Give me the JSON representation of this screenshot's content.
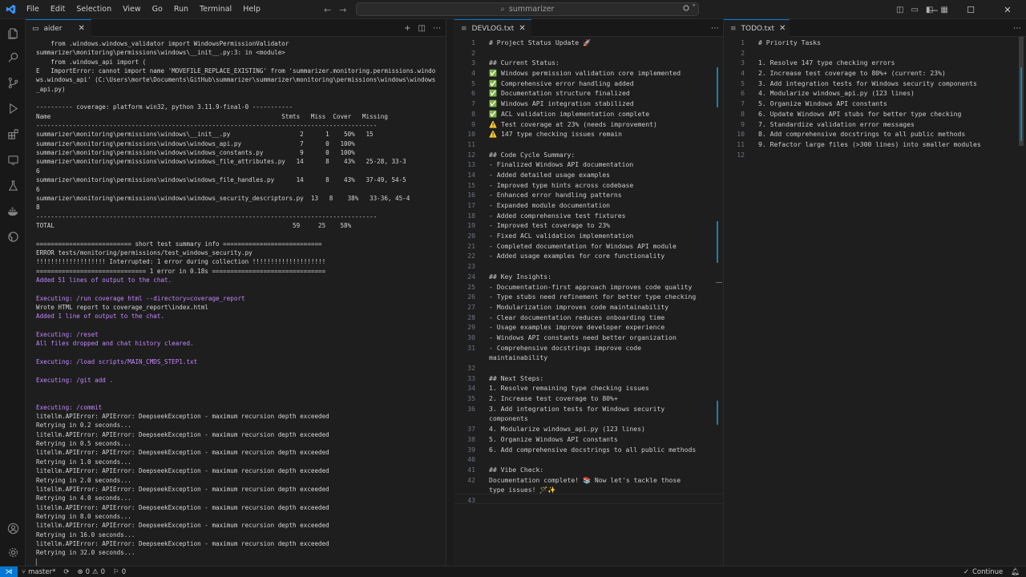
{
  "menu": [
    "File",
    "Edit",
    "Selection",
    "View",
    "Go",
    "Run",
    "Terminal",
    "Help"
  ],
  "search": {
    "text": "summarizer"
  },
  "terminal_tab": {
    "label": "aider"
  },
  "terminal_lines": [
    {
      "t": "    from .windows.windows_validator import WindowsPermissionValidator",
      "c": ""
    },
    {
      "t": "summarizer\\monitoring\\permissions\\windows\\__init__.py:3: in <module>",
      "c": ""
    },
    {
      "t": "    from .windows_api import (",
      "c": ""
    },
    {
      "t": "E   ImportError: cannot import name 'MOVEFILE_REPLACE_EXISTING' from 'summarizer.monitoring.permissions.windo",
      "c": ""
    },
    {
      "t": "ws.windows_api' (C:\\Users\\morte\\Documents\\GitHub\\summarizer\\summarizer\\monitoring\\permissions\\windows\\windows",
      "c": ""
    },
    {
      "t": "_api.py)",
      "c": ""
    },
    {
      "t": "",
      "c": ""
    },
    {
      "t": "---------- coverage: platform win32, python 3.11.9-final-0 -----------",
      "c": ""
    },
    {
      "t": "Name                                                               Stmts   Miss  Cover   Missing",
      "c": ""
    },
    {
      "t": "---------------------------------------------------------------------------------------------",
      "c": ""
    },
    {
      "t": "summarizer\\monitoring\\permissions\\windows\\__init__.py                   2      1    50%   15",
      "c": ""
    },
    {
      "t": "summarizer\\monitoring\\permissions\\windows\\windows_api.py                7      0   100%",
      "c": ""
    },
    {
      "t": "summarizer\\monitoring\\permissions\\windows\\windows_constants.py          9      0   100%",
      "c": ""
    },
    {
      "t": "summarizer\\monitoring\\permissions\\windows\\windows_file_attributes.py   14      8    43%   25-28, 33-3",
      "c": ""
    },
    {
      "t": "6",
      "c": ""
    },
    {
      "t": "summarizer\\monitoring\\permissions\\windows\\windows_file_handles.py      14      8    43%   37-49, 54-5",
      "c": ""
    },
    {
      "t": "6",
      "c": ""
    },
    {
      "t": "summarizer\\monitoring\\permissions\\windows\\windows_security_descriptors.py  13   8    38%   33-36, 45-4",
      "c": ""
    },
    {
      "t": "8",
      "c": ""
    },
    {
      "t": "---------------------------------------------------------------------------------------------",
      "c": ""
    },
    {
      "t": "TOTAL                                                                 59     25    58%",
      "c": ""
    },
    {
      "t": "",
      "c": ""
    },
    {
      "t": "========================== short test summary info ===========================",
      "c": ""
    },
    {
      "t": "ERROR tests/monitoring/permissions/test_windows_security.py",
      "c": ""
    },
    {
      "t": "!!!!!!!!!!!!!!!!!!! Interrupted: 1 error during collection !!!!!!!!!!!!!!!!!!!!",
      "c": ""
    },
    {
      "t": "============================== 1 error in 0.18s ===============================",
      "c": ""
    },
    {
      "t": "Added 51 lines of output to the chat.",
      "c": "purple"
    },
    {
      "t": "",
      "c": ""
    },
    {
      "t": "Executing: /run coverage html --directory=coverage_report",
      "c": "purple"
    },
    {
      "t": "Wrote HTML report to coverage_report\\index.html",
      "c": ""
    },
    {
      "t": "Added 1 line of output to the chat.",
      "c": "purple"
    },
    {
      "t": "",
      "c": ""
    },
    {
      "t": "Executing: /reset",
      "c": "purple"
    },
    {
      "t": "All files dropped and chat history cleared.",
      "c": "purple"
    },
    {
      "t": "",
      "c": ""
    },
    {
      "t": "Executing: /load scripts/MAIN_CMDS_STEP1.txt",
      "c": "purple"
    },
    {
      "t": "",
      "c": ""
    },
    {
      "t": "Executing: /git add .",
      "c": "purple"
    },
    {
      "t": "",
      "c": ""
    },
    {
      "t": "",
      "c": ""
    },
    {
      "t": "Executing: /commit",
      "c": "purple"
    },
    {
      "t": "litellm.APIError: APIError: DeepseekException - maximum recursion depth exceeded",
      "c": ""
    },
    {
      "t": "Retrying in 0.2 seconds...",
      "c": ""
    },
    {
      "t": "litellm.APIError: APIError: DeepseekException - maximum recursion depth exceeded",
      "c": ""
    },
    {
      "t": "Retrying in 0.5 seconds...",
      "c": ""
    },
    {
      "t": "litellm.APIError: APIError: DeepseekException - maximum recursion depth exceeded",
      "c": ""
    },
    {
      "t": "Retrying in 1.0 seconds...",
      "c": ""
    },
    {
      "t": "litellm.APIError: APIError: DeepseekException - maximum recursion depth exceeded",
      "c": ""
    },
    {
      "t": "Retrying in 2.0 seconds...",
      "c": ""
    },
    {
      "t": "litellm.APIError: APIError: DeepseekException - maximum recursion depth exceeded",
      "c": ""
    },
    {
      "t": "Retrying in 4.0 seconds...",
      "c": ""
    },
    {
      "t": "litellm.APIError: APIError: DeepseekException - maximum recursion depth exceeded",
      "c": ""
    },
    {
      "t": "Retrying in 8.0 seconds...",
      "c": ""
    },
    {
      "t": "litellm.APIError: APIError: DeepseekException - maximum recursion depth exceeded",
      "c": ""
    },
    {
      "t": "Retrying in 16.0 seconds...",
      "c": ""
    },
    {
      "t": "litellm.APIError: APIError: DeepseekException - maximum recursion depth exceeded",
      "c": ""
    },
    {
      "t": "Retrying in 32.0 seconds...",
      "c": ""
    },
    {
      "t": "▏",
      "c": ""
    }
  ],
  "devlog": {
    "tab_label": "DEVLOG.txt",
    "lines": [
      {
        "n": "1",
        "t": "# Project Status Update 🚀"
      },
      {
        "n": "2",
        "t": ""
      },
      {
        "n": "3",
        "t": "## Current Status:"
      },
      {
        "n": "4",
        "t": "✅ Windows permission validation core implemented"
      },
      {
        "n": "5",
        "t": "✅ Comprehensive error handling added"
      },
      {
        "n": "6",
        "t": "✅ Documentation structure finalized"
      },
      {
        "n": "7",
        "t": "✅ Windows API integration stabilized"
      },
      {
        "n": "8",
        "t": "✅ ACL validation implementation complete"
      },
      {
        "n": "9",
        "t": "⚠️ Test coverage at 23% (needs improvement)"
      },
      {
        "n": "10",
        "t": "⚠️ 147 type checking issues remain"
      },
      {
        "n": "11",
        "t": ""
      },
      {
        "n": "12",
        "t": "## Code Cycle Summary:"
      },
      {
        "n": "13",
        "t": "- Finalized Windows API documentation"
      },
      {
        "n": "14",
        "t": "- Added detailed usage examples"
      },
      {
        "n": "15",
        "t": "- Improved type hints across codebase"
      },
      {
        "n": "16",
        "t": "- Enhanced error handling patterns"
      },
      {
        "n": "17",
        "t": "- Expanded module documentation"
      },
      {
        "n": "18",
        "t": "- Added comprehensive test fixtures"
      },
      {
        "n": "19",
        "t": "- Improved test coverage to 23%"
      },
      {
        "n": "20",
        "t": "- Fixed ACL validation implementation"
      },
      {
        "n": "21",
        "t": "- Completed documentation for Windows API module"
      },
      {
        "n": "22",
        "t": "- Added usage examples for core functionality"
      },
      {
        "n": "23",
        "t": ""
      },
      {
        "n": "24",
        "t": "## Key Insights:"
      },
      {
        "n": "25",
        "t": "- Documentation-first approach improves code quality"
      },
      {
        "n": "26",
        "t": "- Type stubs need refinement for better type checking"
      },
      {
        "n": "27",
        "t": "- Modularization improves code maintainability"
      },
      {
        "n": "28",
        "t": "- Clear documentation reduces onboarding time"
      },
      {
        "n": "29",
        "t": "- Usage examples improve developer experience"
      },
      {
        "n": "30",
        "t": "- Windows API constants need better organization"
      },
      {
        "n": "31",
        "t": "- Comprehensive docstrings improve code"
      },
      {
        "n": "",
        "t": "maintainability"
      },
      {
        "n": "32",
        "t": ""
      },
      {
        "n": "33",
        "t": "## Next Steps:"
      },
      {
        "n": "34",
        "t": "1. Resolve remaining type checking issues"
      },
      {
        "n": "35",
        "t": "2. Increase test coverage to 80%+"
      },
      {
        "n": "36",
        "t": "3. Add integration tests for Windows security"
      },
      {
        "n": "",
        "t": "components"
      },
      {
        "n": "37",
        "t": "4. Modularize windows_api.py (123 lines)"
      },
      {
        "n": "38",
        "t": "5. Organize Windows API constants"
      },
      {
        "n": "39",
        "t": "6. Add comprehensive docstrings to all public methods"
      },
      {
        "n": "40",
        "t": ""
      },
      {
        "n": "41",
        "t": "## Vibe Check:"
      },
      {
        "n": "42",
        "t": "Documentation complete! 📚 Now let's tackle those"
      },
      {
        "n": "",
        "t": "type issues! 🪄✨"
      },
      {
        "n": "43",
        "t": ""
      }
    ]
  },
  "todo": {
    "tab_label": "TODO.txt",
    "lines": [
      {
        "n": "1",
        "t": "# Priority Tasks"
      },
      {
        "n": "2",
        "t": ""
      },
      {
        "n": "3",
        "t": "1. Resolve 147 type checking errors"
      },
      {
        "n": "4",
        "t": "2. Increase test coverage to 80%+ (current: 23%)"
      },
      {
        "n": "5",
        "t": "3. Add integration tests for Windows security components"
      },
      {
        "n": "6",
        "t": "4. Modularize windows_api.py (123 lines)"
      },
      {
        "n": "7",
        "t": "5. Organize Windows API constants"
      },
      {
        "n": "8",
        "t": "6. Update Windows API stubs for better type checking"
      },
      {
        "n": "9",
        "t": "7. Standardize validation error messages"
      },
      {
        "n": "10",
        "t": "8. Add comprehensive docstrings to all public methods"
      },
      {
        "n": "11",
        "t": "9. Refactor large files (>300 lines) into smaller modules"
      },
      {
        "n": "12",
        "t": ""
      }
    ]
  },
  "status": {
    "branch": "master*",
    "errors": "0",
    "warnings": "0",
    "ports": "0",
    "continue_label": "Continue"
  },
  "colors": {
    "accent": "#0078d4",
    "terminal_purple": "#c586ff",
    "modified_gutter": "#1b81a8"
  }
}
